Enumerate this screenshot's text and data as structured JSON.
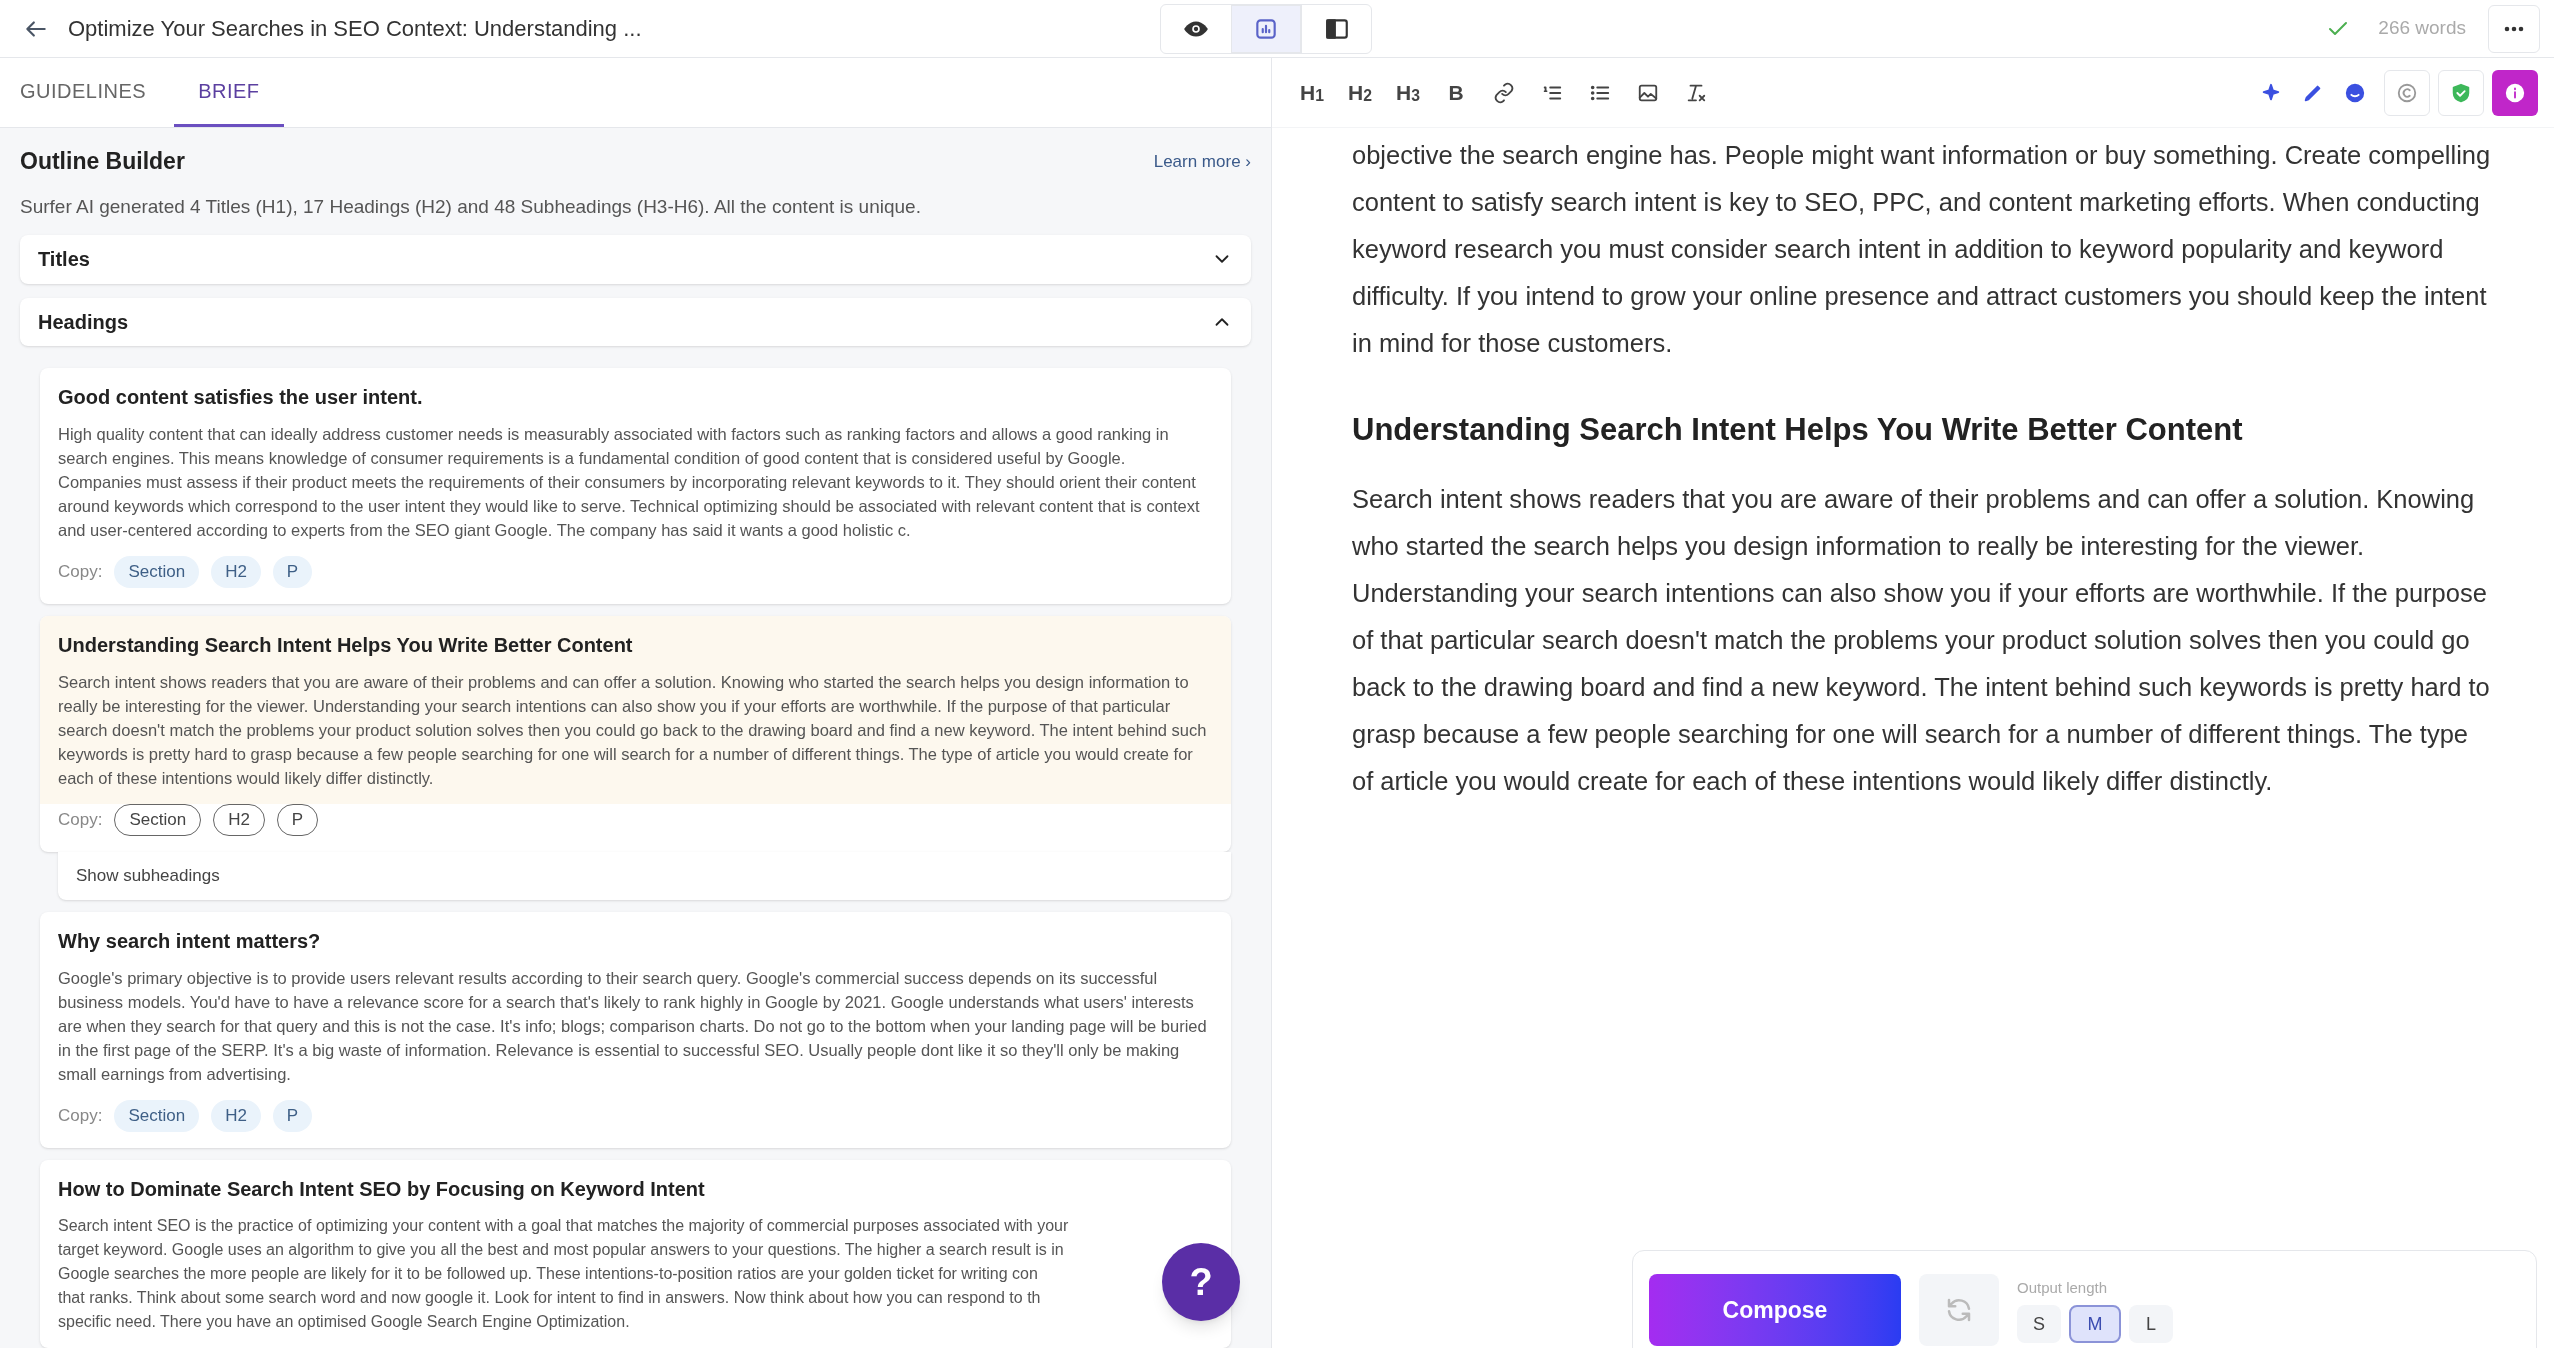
{
  "header": {
    "title": "Optimize Your Searches in SEO Context: Understanding ...",
    "views": [
      {
        "kind": "preview",
        "selected": false
      },
      {
        "kind": "outline",
        "selected": true
      },
      {
        "kind": "sidebar",
        "selected": false
      }
    ],
    "saved": true,
    "word_count": "266 words"
  },
  "tabs": [
    {
      "label": "GUIDELINES",
      "selected": false
    },
    {
      "label": "BRIEF",
      "selected": true
    }
  ],
  "outline": {
    "title": "Outline Builder",
    "learn_more": "Learn more ›",
    "summary": "Surfer AI generated 4 Titles (H1), 17 Headings (H2) and 48 Subheadings (H3-H6). All the content is unique.",
    "sections": [
      {
        "label": "Titles",
        "expanded": false
      },
      {
        "label": "Headings",
        "expanded": true
      }
    ],
    "items": [
      {
        "kind": "heading",
        "hovered": false,
        "title": "Good content satisfies the user intent.",
        "text": "High quality content that can ideally address customer needs is measurably associated with factors such as ranking factors and allows a good ranking in search engines. This means knowledge of consumer requirements is a fundamental condition of good content that is considered useful by Google. Companies must assess if their product meets the requirements of their consumers by incorporating relevant keywords to it. They should orient their content around keywords which correspond to the user intent they would like to serve. Technical optimizing should be associated with relevant content that is context and user-centered according to experts from the SEO giant Google. The company has said it wants a good holistic c.",
        "copy_label": "Copy:",
        "copy_buttons": [
          "Section",
          "H2",
          "P"
        ]
      },
      {
        "kind": "heading",
        "hovered": true,
        "title": "Understanding Search Intent Helps You Write Better Content",
        "text": "Search intent shows readers that you are aware of their problems and can offer a solution. Knowing who started the search helps you design information to really be interesting for the viewer. Understanding your search intentions can also show you if your efforts are worthwhile. If the purpose of that particular search doesn't match the problems your product solution solves then you could go back to the drawing board and find a new keyword. The intent behind such keywords is pretty hard to grasp because a few people searching for one will search for a number of different things. The type of article you would create for each of these intentions would likely differ distinctly.",
        "copy_label": "Copy:",
        "copy_buttons": [
          "Section",
          "H2",
          "P"
        ]
      },
      {
        "kind": "subheadings_toggle",
        "label": "Show subheadings"
      },
      {
        "kind": "heading",
        "hovered": false,
        "title": "Why search intent matters?",
        "text": "Google's primary objective is to provide users relevant results according to their search query. Google's commercial success depends on its successful business models. You'd have to have a relevance score for a search that's likely to rank highly in Google by 2021. Google understands what users' interests are when they search for that query and this is not the case. It's info; blogs; comparison charts. Do not go to the bottom when your landing page will be buried in the first page of the SERP. It's a big waste of information. Relevance is essential to successful SEO. Usually people dont like it so they'll only be making small earnings from advertising.",
        "copy_label": "Copy:",
        "copy_buttons": [
          "Section",
          "H2",
          "P"
        ]
      },
      {
        "kind": "heading",
        "hovered": false,
        "title": "How to Dominate Search Intent SEO by Focusing on Keyword Intent",
        "lines": [
          "Search intent SEO is the practice of optimizing your content with a goal that matches the majority of commercial purposes associated with your",
          "target keyword. Google uses an algorithm to give you all the best and most popular answers to your questions. The higher a search result is in",
          "Google searches the more people are likely for it to be followed up. These intentions-to-position ratios are your golden ticket for writing con",
          "that ranks. Think about some search word and now google it. Look for intent to find in answers. Now think about how you can respond to th",
          "specific need. There you have an optimised Google Search Engine Optimization."
        ]
      }
    ]
  },
  "help": "?",
  "toolbar": {
    "left": [
      {
        "kind": "text",
        "label": "H$_{1}$"
      },
      {
        "kind": "text",
        "label": "H$_{2}$"
      },
      {
        "kind": "text",
        "label": "H$_{3}$"
      },
      {
        "kind": "text",
        "label": "B"
      },
      {
        "kind": "link"
      },
      {
        "kind": "ordered"
      },
      {
        "kind": "bullets"
      },
      {
        "kind": "image"
      },
      {
        "kind": "clear"
      }
    ],
    "right": [
      {
        "kind": "sparkle"
      },
      {
        "kind": "pen"
      },
      {
        "kind": "smiley"
      },
      {
        "kind": "copyright"
      },
      {
        "kind": "shield"
      },
      {
        "kind": "info"
      }
    ]
  },
  "content": [
    {
      "kind": "paragraph",
      "text": "objective the search engine has. People might want information or buy something. Create compelling content to satisfy search intent is key to SEO, PPC, and content marketing efforts. When conducting keyword research you must consider search intent in addition to keyword popularity and keyword difficulty. If you intend to grow your online presence and attract customers you should keep the intent in mind for those customers."
    },
    {
      "kind": "heading",
      "text": "Understanding Search Intent Helps You Write Better Content"
    },
    {
      "kind": "paragraph",
      "text": "Search intent shows readers that you are aware of their problems and can offer a solution. Knowing who started the search helps you design information to really be interesting for the viewer. Understanding your search intentions can also show you if your efforts are worthwhile. If the purpose of that particular search doesn't match the problems your product solution solves then you could go back to the drawing board and find a new keyword. The intent behind such keywords is pretty hard to grasp because a few people searching for one will search for a number of different things. The type of article you would create for each of these intentions would likely differ distinctly."
    }
  ],
  "compose": {
    "button": "Compose",
    "output_length_label": "Output length",
    "sizes": [
      {
        "label": "S",
        "selected": false
      },
      {
        "label": "M",
        "selected": true
      },
      {
        "label": "L",
        "selected": false
      }
    ]
  }
}
